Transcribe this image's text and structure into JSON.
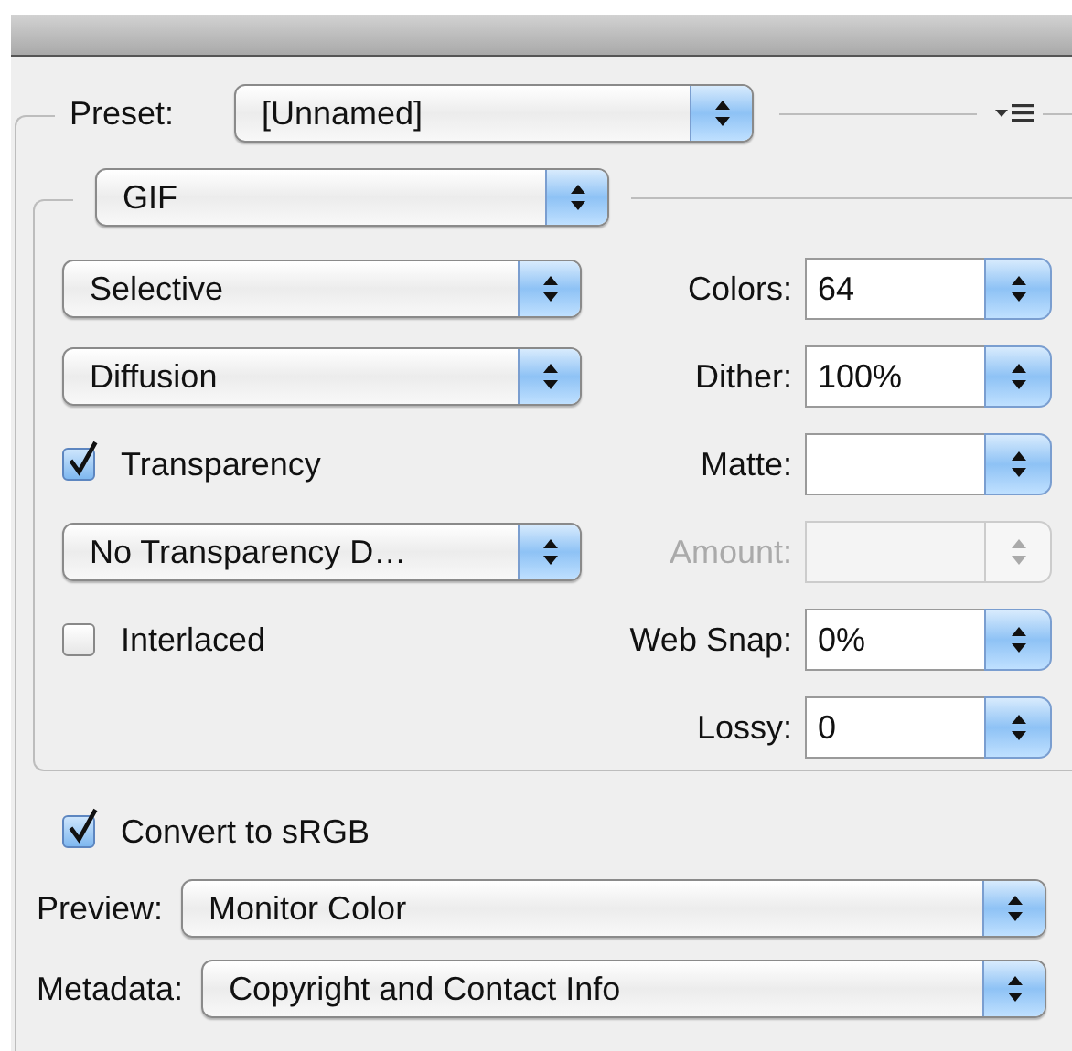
{
  "preset": {
    "label": "Preset:",
    "value": "[Unnamed]"
  },
  "format": {
    "value": "GIF"
  },
  "rows": [
    {
      "left": {
        "kind": "dropdown",
        "value": "Selective"
      },
      "right": {
        "label": "Colors:",
        "value": "64",
        "disabled": false
      }
    },
    {
      "left": {
        "kind": "dropdown",
        "value": "Diffusion"
      },
      "right": {
        "label": "Dither:",
        "value": "100%",
        "disabled": false
      }
    },
    {
      "left": {
        "kind": "checkbox",
        "label": "Transparency",
        "checked": true
      },
      "right": {
        "label": "Matte:",
        "disabled": false
      }
    },
    {
      "left": {
        "kind": "dropdown",
        "value": "No Transparency D…"
      },
      "right": {
        "label": "Amount:",
        "disabled": true
      }
    },
    {
      "left": {
        "kind": "checkbox",
        "label": "Interlaced",
        "checked": false
      },
      "right": {
        "label": "Web Snap:",
        "value": "0%",
        "disabled": false
      }
    },
    {
      "right": {
        "label": "Lossy:",
        "value": "0",
        "disabled": false
      }
    }
  ],
  "convert": {
    "label": "Convert to sRGB",
    "checked": true
  },
  "preview": {
    "label": "Preview:",
    "value": "Monitor Color"
  },
  "metadata": {
    "label": "Metadata:",
    "value": "Copyright and Contact Info"
  }
}
